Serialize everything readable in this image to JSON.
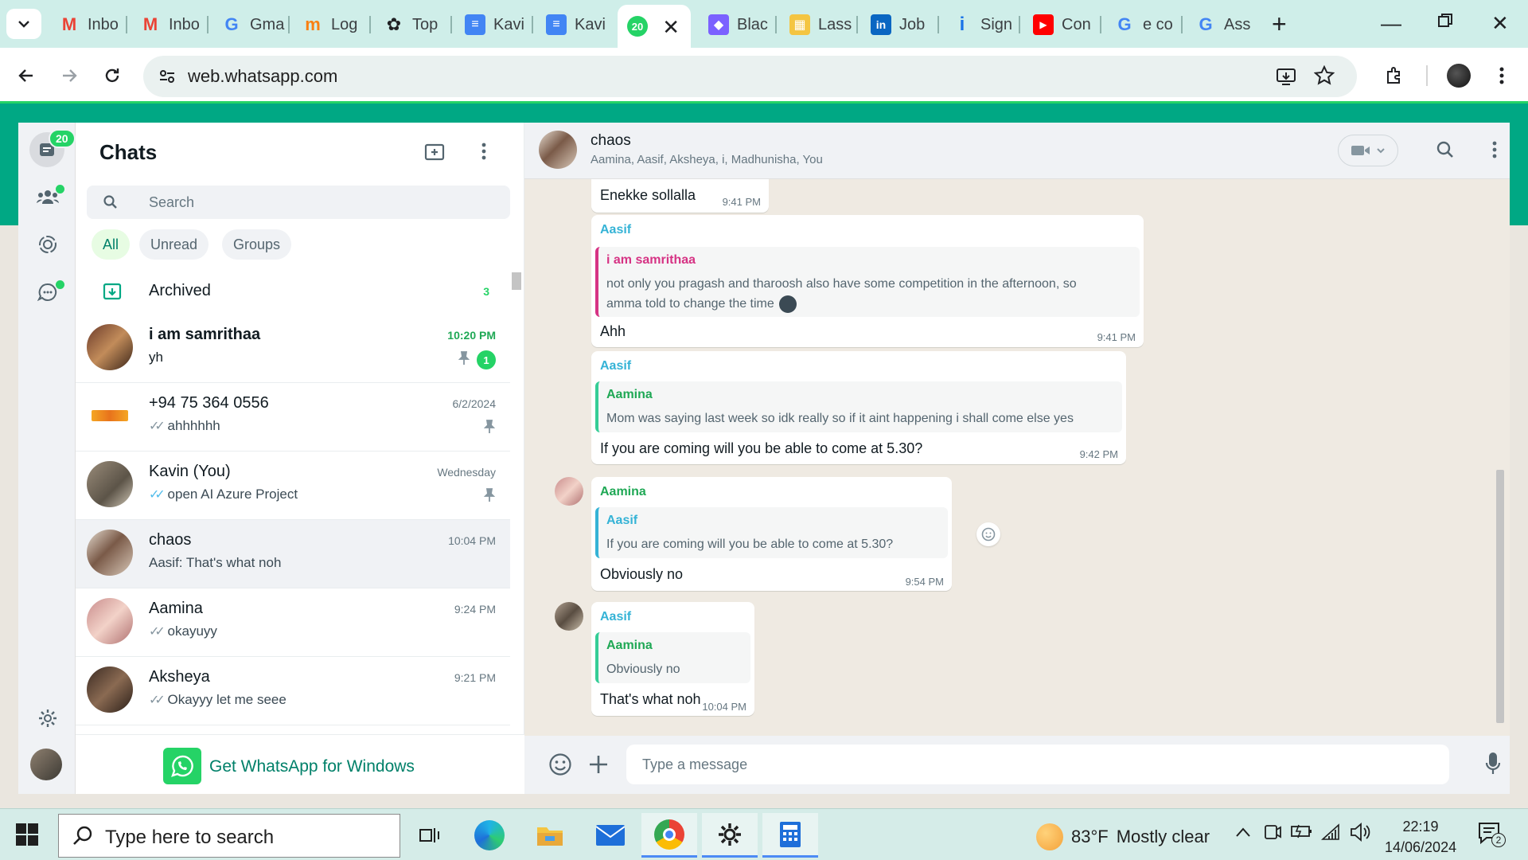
{
  "browser": {
    "tabs": [
      {
        "label": "Inbo",
        "icon": "gmail-icon"
      },
      {
        "label": "Inbo",
        "icon": "gmail-icon"
      },
      {
        "label": "Gma",
        "icon": "google-icon"
      },
      {
        "label": "Log",
        "icon": "moodle-icon"
      },
      {
        "label": "Top",
        "icon": "openai-icon"
      },
      {
        "label": "Kavi",
        "icon": "docs-icon"
      },
      {
        "label": "Kavi",
        "icon": "docs-icon"
      },
      {
        "label": "20",
        "icon": "whatsapp-icon",
        "active": true
      },
      {
        "label": "Blac",
        "icon": "blackbox-icon"
      },
      {
        "label": "Lass",
        "icon": "lassonde-icon"
      },
      {
        "label": "Job",
        "icon": "linkedin-icon"
      },
      {
        "label": "Sign",
        "icon": "info-icon"
      },
      {
        "label": "Con",
        "icon": "youtube-icon"
      },
      {
        "label": "e co",
        "icon": "google-icon"
      },
      {
        "label": "Ass",
        "icon": "google-icon"
      }
    ],
    "url": "web.whatsapp.com"
  },
  "rail": {
    "chats_badge": "20"
  },
  "chatlist": {
    "title": "Chats",
    "search_placeholder": "Search",
    "filters": [
      "All",
      "Unread",
      "Groups"
    ],
    "archived": {
      "label": "Archived",
      "count": "3"
    },
    "rows": [
      {
        "name": "i am samrithaa",
        "preview": "yh",
        "time": "10:20 PM",
        "unread": "1",
        "pinned": true,
        "ticks": false
      },
      {
        "name": "+94 75 364 0556",
        "preview": "ahhhhhh",
        "time": "6/2/2024",
        "pinned": true,
        "ticks": true
      },
      {
        "name": "Kavin (You)",
        "preview": "open AI Azure Project",
        "time": "Wednesday",
        "pinned": true,
        "ticks": true
      },
      {
        "name": "chaos",
        "preview": "Aasif: That's what noh",
        "time": "10:04 PM",
        "ticks": false,
        "selected": true
      },
      {
        "name": "Aamina",
        "preview": "okayuyy",
        "time": "9:24 PM",
        "ticks": true
      },
      {
        "name": "Aksheya",
        "preview": "Okayyy let me seee",
        "time": "9:21 PM",
        "ticks": true
      }
    ],
    "get_app": "Get WhatsApp for Windows"
  },
  "conversation": {
    "name": "chaos",
    "members": "Aamina, Aasif, Aksheya, i, Madhunisha, You",
    "messages": [
      {
        "text": "Enekke sollalla",
        "time": "9:41 PM"
      },
      {
        "sender": "Aasif",
        "quote_sender": "i am samrithaa",
        "quote_lines": [
          "not only you pragash and tharoosh also have some competition in the afternoon, so",
          "amma told to change the time"
        ],
        "text": "Ahh",
        "time": "9:41 PM"
      },
      {
        "sender": "Aasif",
        "quote_sender": "Aamina",
        "quote_lines": [
          "Mom was saying last week so idk really so if it aint happening i shall come else yes"
        ],
        "text": "If you are coming will you be able to come at 5.30?",
        "time": "9:42 PM"
      },
      {
        "sender": "Aamina",
        "quote_sender": "Aasif",
        "quote_lines": [
          "If you are coming will you be able to come at 5.30?"
        ],
        "text": "Obviously no",
        "time": "9:54 PM"
      },
      {
        "sender": "Aasif",
        "quote_sender": "Aamina",
        "quote_lines": [
          "Obviously no"
        ],
        "text": "That's what noh",
        "time": "10:04 PM"
      }
    ],
    "composer_placeholder": "Type a message"
  },
  "taskbar": {
    "search_placeholder": "Type here to search",
    "weather_temp": "83°F",
    "weather_text": "Mostly clear",
    "time": "22:19",
    "date": "14/06/2024",
    "notifications": "2"
  },
  "colors": {
    "accent": "#00a884",
    "green": "#25d366",
    "aasif": "#35b3d6",
    "aamina": "#1fa855",
    "samrithaa": "#d63384"
  }
}
